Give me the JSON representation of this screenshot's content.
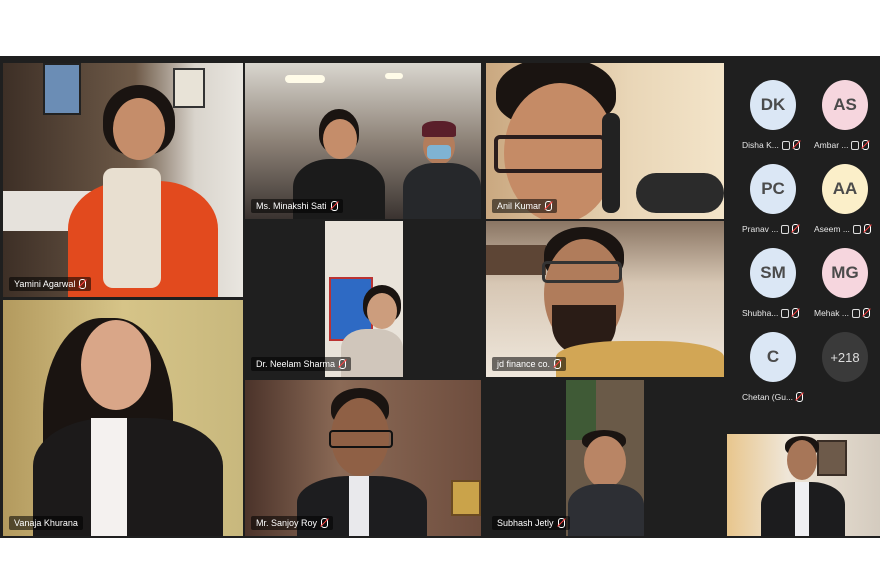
{
  "participants": {
    "yamini": "Yamini Agarwal",
    "minakshi": "Ms. Minakshi Sati",
    "anil": "Anil Kumar",
    "neelam": "Dr. Neelam Sharma",
    "jd": "jd finance co.",
    "vanaja": "Vanaja Khurana",
    "sanjoy": "Mr. Sanjoy Roy",
    "subhash": "Subhash Jetly"
  },
  "sidebar": {
    "people": [
      {
        "initials": "DK",
        "name": "Disha K...",
        "color": "#dbe7f5"
      },
      {
        "initials": "AS",
        "name": "Ambar ...",
        "color": "#f6d6de"
      },
      {
        "initials": "PC",
        "name": "Pranav ...",
        "color": "#dbe7f5"
      },
      {
        "initials": "AA",
        "name": "Aseem ...",
        "color": "#fbefc9"
      },
      {
        "initials": "SM",
        "name": "Shubha...",
        "color": "#dbe7f5"
      },
      {
        "initials": "MG",
        "name": "Mehak ...",
        "color": "#f6d6de"
      },
      {
        "initials": "C",
        "name": "Chetan (Gu...",
        "color": "#dbe7f5"
      }
    ],
    "more_count": "+218"
  },
  "colors": {
    "active_outline": "#6d8cff",
    "background": "#1f1f1f"
  }
}
